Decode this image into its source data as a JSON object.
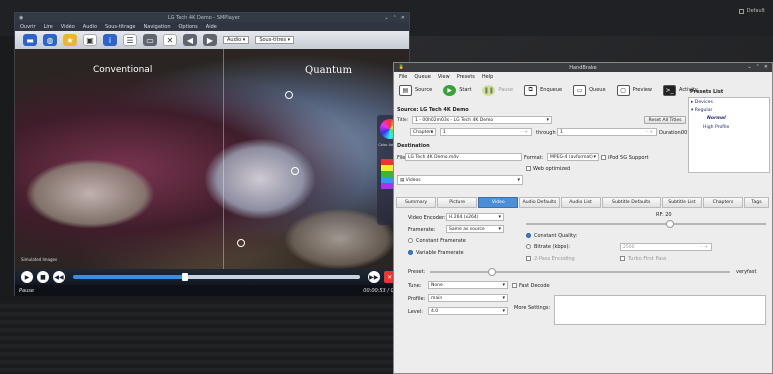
{
  "desktop": {
    "default_label": "Default"
  },
  "smplayer": {
    "title": "LG Tech 4K Demo - SMPlayer",
    "menu": [
      "Ouvrir",
      "Lire",
      "Vidéo",
      "Audio",
      "Sous-titrage",
      "Navigation",
      "Options",
      "Aide"
    ],
    "toolbar": {
      "audio_select": "Audio",
      "subtitle_select": "Sous-titres"
    },
    "video": {
      "left_label": "Conventional",
      "right_label": "Quantum",
      "simulated": "Simulated Images"
    },
    "status": {
      "state": "Pause",
      "time": "00:00:53 / 00:01"
    }
  },
  "handbrake": {
    "title": "HandBrake",
    "menu": [
      "File",
      "Queue",
      "View",
      "Presets",
      "Help"
    ],
    "toolbar": [
      "Source",
      "Start",
      "Pause",
      "Enqueue",
      "Queue",
      "Preview",
      "Activity"
    ],
    "source": {
      "label": "Source:",
      "value": "LG Tech 4K Demo"
    },
    "title_row": {
      "label": "Title:",
      "value": "1 - 00h02m03s - LG Tech 4K Demo",
      "reset": "Reset All Titles"
    },
    "chapters": {
      "label": "Chapters",
      "from": "1",
      "through_label": "through",
      "through": "1",
      "duration_label": "Duration:",
      "duration": "00:02:03"
    },
    "destination": {
      "label": "Destination",
      "file_label": "File:",
      "file": "LG Tech 4K Demo.m4v",
      "folder": "Videos",
      "format_label": "Format:",
      "format": "MPEG-4 (avformat)",
      "ipod": "iPod 5G Support",
      "web": "Web optimized"
    },
    "presets": {
      "label": "Presets List",
      "items": [
        "Devices",
        "Regular",
        "Normal",
        "High Profile"
      ]
    },
    "tabs": [
      "Summary",
      "Picture",
      "Video",
      "Audio Defaults",
      "Audio List",
      "Subtitle Defaults",
      "Subtitle List",
      "Chapters",
      "Tags"
    ],
    "video": {
      "encoder_label": "Video Encoder:",
      "encoder": "H.264 (x264)",
      "framerate_label": "Framerate:",
      "framerate": "Same as source",
      "constant_framerate": "Constant Framerate",
      "variable_framerate": "Variable Framerate",
      "rf_label": "RF: 20",
      "constant_quality": "Constant Quality:",
      "bitrate": "Bitrate (kbps):",
      "bitrate_value": "2500",
      "two_pass": "2-Pass Encoding",
      "turbo": "Turbo First Pass",
      "preset_label": "Preset:",
      "preset_end": "veryfast",
      "tune_label": "Tune:",
      "tune": "None",
      "fast_decode": "Fast Decode",
      "profile_label": "Profile:",
      "profile": "main",
      "more_settings": "More Settings:",
      "level_label": "Level:",
      "level": "4.0"
    }
  }
}
